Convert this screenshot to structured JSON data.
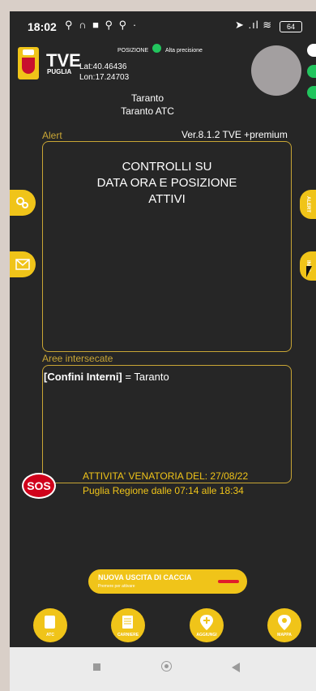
{
  "status_bar": {
    "time": "18:02",
    "notification_icons": "⚲ ∩ ■ ⚲ ⚲ ·",
    "right_icons": "➤ .ıl ≋",
    "battery": "64"
  },
  "header": {
    "brand": "TVE",
    "brand_sub": "PUGLIA",
    "lat": "Lat:40.46436",
    "lon": "Lon:17.24703",
    "position_label": "POSIZIONE",
    "precision_label": "Alta precisione",
    "city": "Taranto",
    "atc": "Taranto ATC"
  },
  "alert": {
    "label": "Alert",
    "version": "Ver.8.1.2 TVE +premium",
    "line1": "CONTROLLI SU",
    "line2": "DATA ORA E POSIZIONE",
    "line3": "ATTIVI"
  },
  "areas": {
    "label": "Aree intersecate",
    "entry_bold": "[Confini Interni]",
    "entry_rest": " = Taranto"
  },
  "side_buttons": {
    "right_top": "ALERT",
    "right_bottom": "INFO"
  },
  "sos_label": "SOS",
  "activity": {
    "line1": "ATTIVITA' VENATORIA DEL: 27/08/22",
    "line2": "Puglia Regione dalle 07:14 alle 18:34"
  },
  "hunt_button": {
    "title": "NUOVA USCITA DI CACCIA",
    "subtitle": "Premere per attivare"
  },
  "bottom_nav": [
    {
      "label": "ATC"
    },
    {
      "label": "CARNIERE"
    },
    {
      "label": "AGGIUNGI"
    },
    {
      "label": "MAPPA"
    }
  ],
  "colors": {
    "accent": "#f0c419",
    "background": "#262626",
    "border_gold": "#c9a635",
    "sos": "#d0021b",
    "ok": "#22c55e"
  }
}
